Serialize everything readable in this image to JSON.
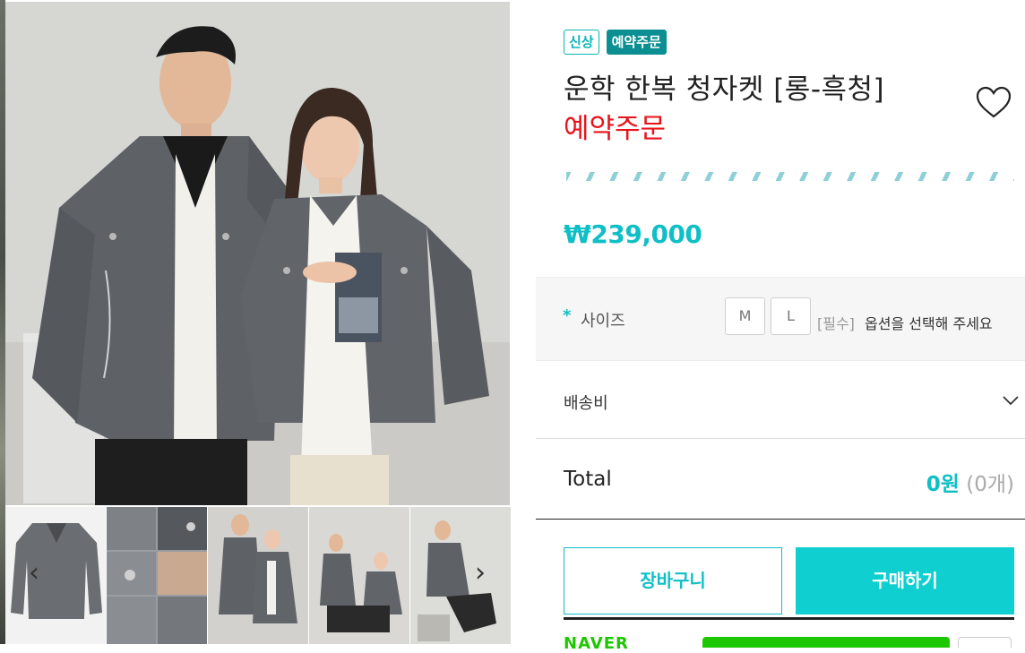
{
  "product": {
    "badge_new": "신상",
    "badge_preorder": "예약주문",
    "title": "운학 한복 청자켓 [롱-흑청]",
    "title_sub": "예약주문",
    "price": "₩239,000"
  },
  "options": {
    "size_star": "*",
    "size_label": "사이즈",
    "sizes": [
      "M",
      "L"
    ],
    "required": "[필수]",
    "hint": "옵션을 선택해 주세요"
  },
  "shipping": {
    "label": "배송비"
  },
  "total": {
    "label": "Total",
    "amount": "0원",
    "count": "(0개)"
  },
  "actions": {
    "cart": "장바구니",
    "buy": "구매하기"
  },
  "naver": {
    "label": "NAVER"
  },
  "gallery": {
    "prev": "‹",
    "next": "›"
  },
  "colors": {
    "accent": "#0fbfc6",
    "buy_bg": "#0fcfd0",
    "sale_red": "#e8141c",
    "badge_dark": "#0c8f93"
  },
  "icons": {
    "wish": "heart-icon",
    "shipping": "chevron-down-icon"
  }
}
